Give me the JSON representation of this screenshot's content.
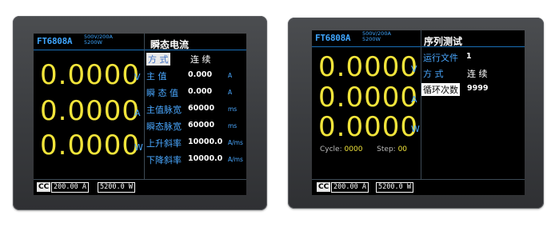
{
  "left_panel": {
    "model": "FT6808A",
    "rating_line1": "500V/200A",
    "rating_line2": "5200W",
    "mode_title": "瞬态电流",
    "readings": [
      {
        "value": "0.0000",
        "unit": "V"
      },
      {
        "value": "0.0000",
        "unit": "A"
      },
      {
        "value": "0.0000",
        "unit": "W"
      }
    ],
    "params": [
      {
        "label": "方   式",
        "value": "连 续",
        "unit": ""
      },
      {
        "label": "主   值",
        "value": "0.000",
        "unit": "A"
      },
      {
        "label": "瞬 态 值",
        "value": "0.000",
        "unit": "A"
      },
      {
        "label": "主值脉宽",
        "value": "60000",
        "unit": "ms"
      },
      {
        "label": "瞬态脉宽",
        "value": "60000",
        "unit": "ms"
      },
      {
        "label": "上升斜率",
        "value": "10000.0",
        "unit": "A/ms"
      },
      {
        "label": "下降斜率",
        "value": "10000.0",
        "unit": "A/ms"
      }
    ],
    "status": {
      "mode": "CC",
      "current": "200.00  A",
      "power": "5200.0  W"
    }
  },
  "right_panel": {
    "model": "FT6808A",
    "rating_line1": "500V/200A",
    "rating_line2": "5200W",
    "mode_title": "序列测试",
    "readings": [
      {
        "value": "0.0000",
        "unit": "V"
      },
      {
        "value": "0.0000",
        "unit": "A"
      },
      {
        "value": "0.0000",
        "unit": "W"
      }
    ],
    "params": [
      {
        "label": "运行文件",
        "value": "1"
      },
      {
        "label": "方   式",
        "value": "连 续"
      },
      {
        "label": "循环次数",
        "value": "9999"
      }
    ],
    "cycle_label": "Cycle:",
    "cycle_value": "0000",
    "step_label": "Step:",
    "step_value": "00",
    "status": {
      "mode": "CC",
      "current": "200.00  A",
      "power": "5200.0  W"
    }
  },
  "colors": {
    "reading": "#f1e43a",
    "label": "#4aa8ff",
    "screen": "#000000"
  }
}
